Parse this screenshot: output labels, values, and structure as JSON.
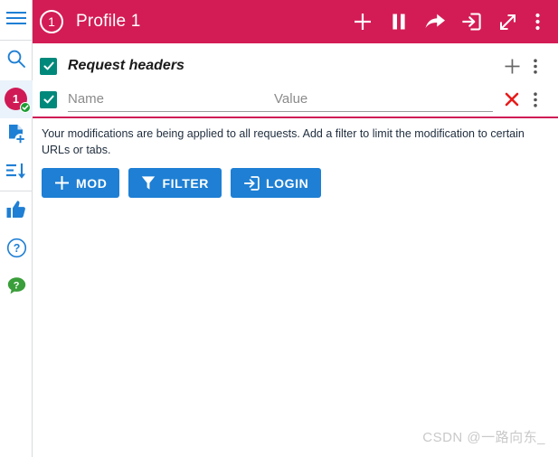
{
  "sidebar": {
    "items": [
      {
        "name": "menu",
        "icon": "hamburger-menu-icon",
        "label": ""
      },
      {
        "name": "search",
        "icon": "search-icon",
        "label": ""
      },
      {
        "name": "profile-badge",
        "icon": "profile-badge-icon",
        "label": "1"
      },
      {
        "name": "new-profile",
        "icon": "add-file-icon",
        "label": ""
      },
      {
        "name": "sort",
        "icon": "sort-descending-icon",
        "label": ""
      },
      {
        "name": "rate",
        "icon": "thumbs-up-icon",
        "label": ""
      },
      {
        "name": "help",
        "icon": "help-circle-icon",
        "label": ""
      },
      {
        "name": "feedback",
        "icon": "chat-question-icon",
        "label": "?"
      }
    ]
  },
  "titlebar": {
    "profile_number": "1",
    "title": "Profile 1",
    "actions": [
      {
        "name": "add",
        "icon": "plus-icon"
      },
      {
        "name": "pause",
        "icon": "pause-icon"
      },
      {
        "name": "share",
        "icon": "share-arrow-icon"
      },
      {
        "name": "login",
        "icon": "login-icon"
      },
      {
        "name": "expand",
        "icon": "expand-icon"
      },
      {
        "name": "more",
        "icon": "more-vertical-icon"
      }
    ]
  },
  "section": {
    "checkbox_checked": true,
    "title": "Request headers",
    "add_label": "",
    "more_label": ""
  },
  "header_row": {
    "checkbox_checked": true,
    "name_value": "",
    "name_placeholder": "Name",
    "value_value": "",
    "value_placeholder": "Value"
  },
  "note": {
    "text": "Your modifications are being applied to all requests. Add a filter to limit the modification to certain URLs or tabs."
  },
  "buttons": [
    {
      "name": "mod",
      "label": "MOD",
      "icon": "plus-icon"
    },
    {
      "name": "filter",
      "label": "FILTER",
      "icon": "funnel-icon"
    },
    {
      "name": "login",
      "label": "LOGIN",
      "icon": "login-icon"
    }
  ],
  "watermark": {
    "text": "CSDN @一路向东_"
  },
  "colors": {
    "crimson": "#d31c55",
    "teal": "#00897b",
    "blue": "#1e7fd4",
    "red": "#e81b1b",
    "green": "#1d9e34"
  }
}
